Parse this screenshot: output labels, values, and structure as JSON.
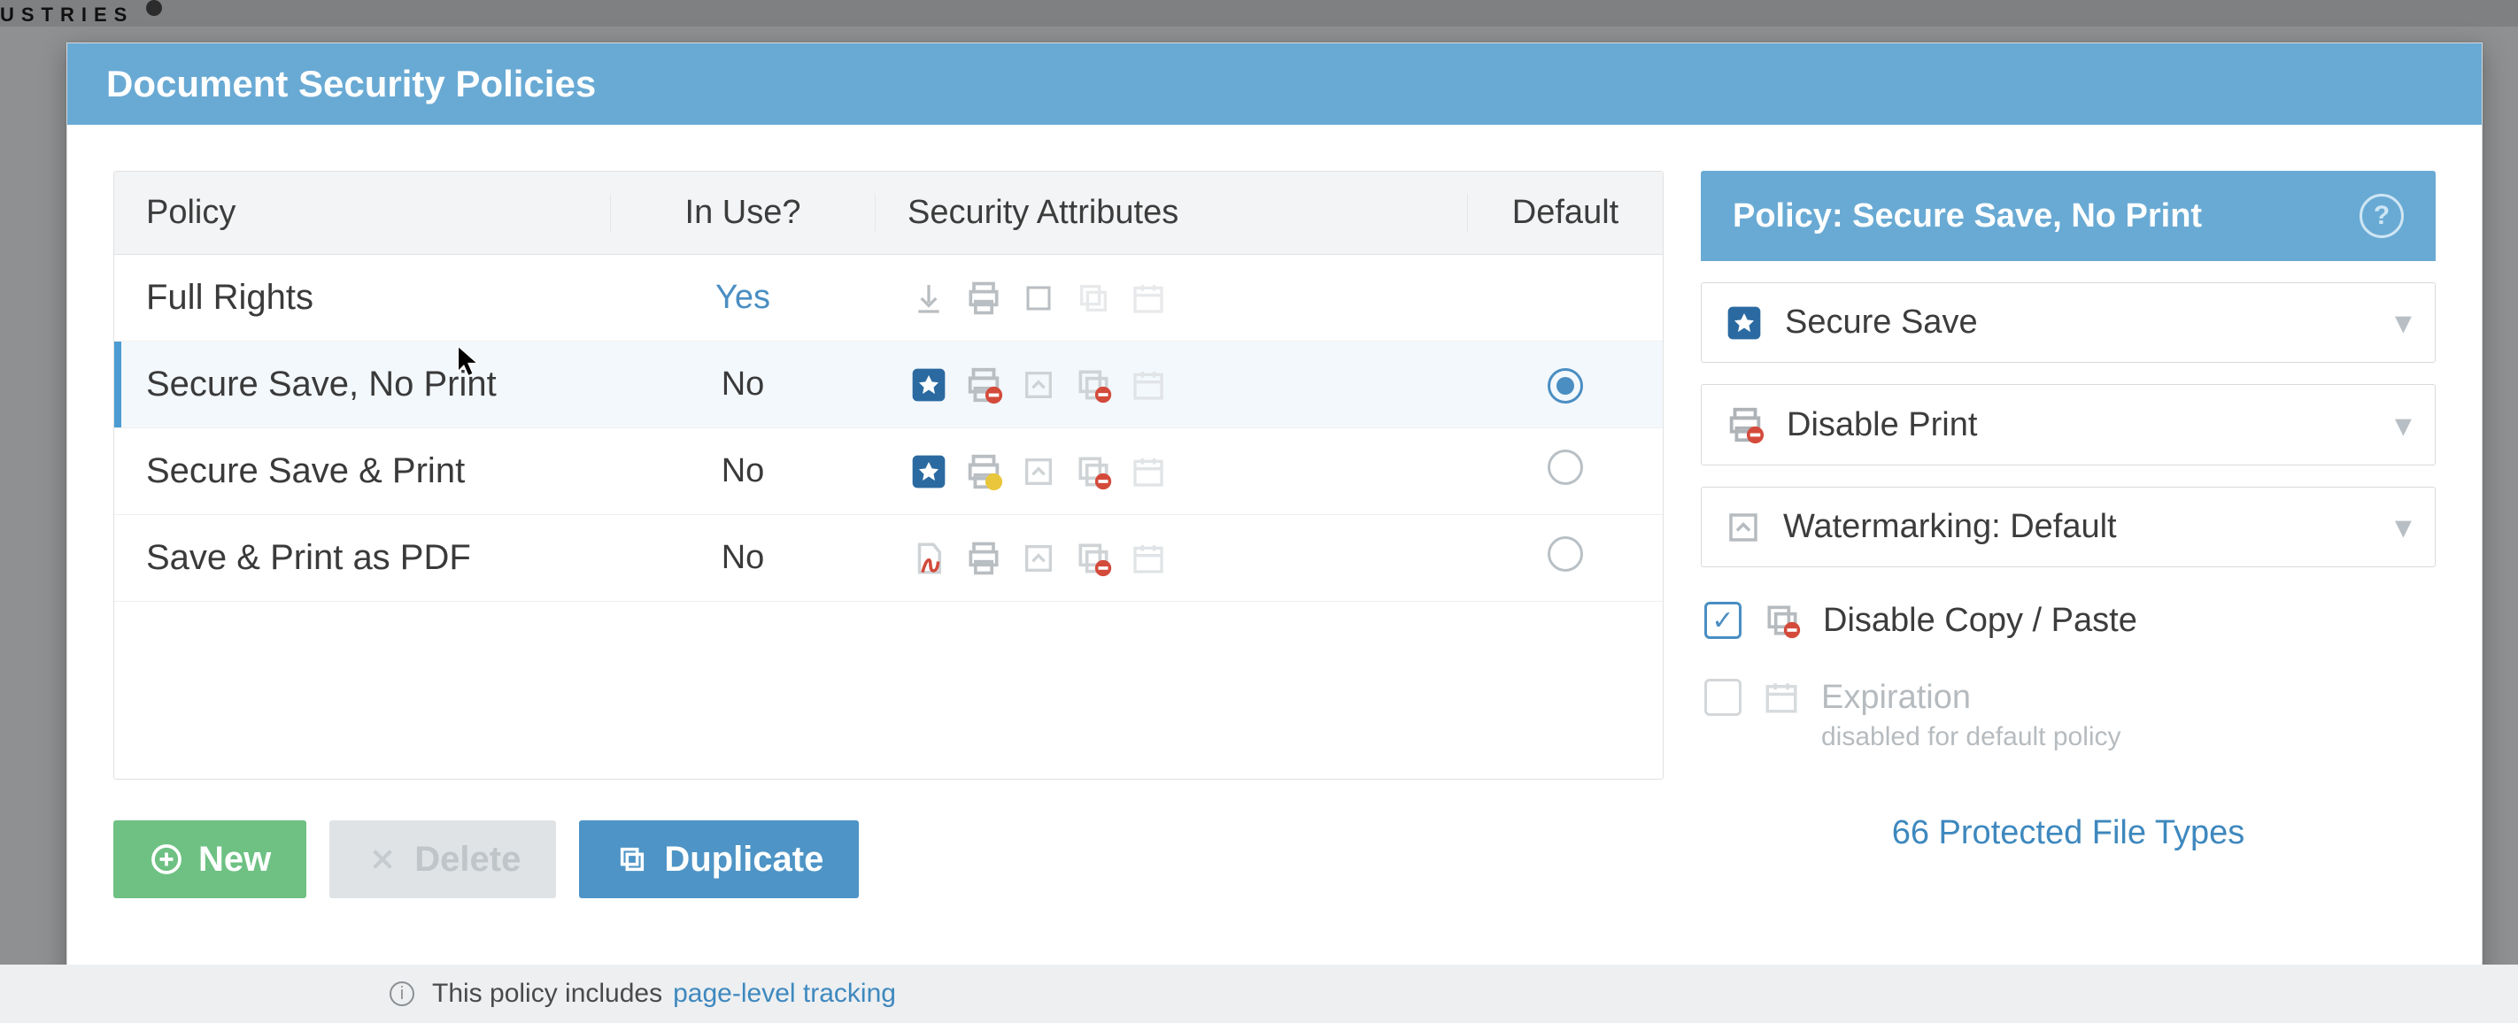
{
  "header": {
    "brand_fragment": "USTRIES"
  },
  "modal": {
    "title": "Document Security Policies"
  },
  "table": {
    "columns": {
      "policy": "Policy",
      "in_use": "In Use?",
      "attrs": "Security Attributes",
      "default": "Default"
    },
    "rows": [
      {
        "name": "Full Rights",
        "in_use": "Yes",
        "selected": false,
        "default": false
      },
      {
        "name": "Secure Save, No Print",
        "in_use": "No",
        "selected": true,
        "default": true
      },
      {
        "name": "Secure Save & Print",
        "in_use": "No",
        "selected": false,
        "default": false
      },
      {
        "name": "Save & Print as PDF",
        "in_use": "No",
        "selected": false,
        "default": false
      }
    ]
  },
  "buttons": {
    "new": "New",
    "delete": "Delete",
    "duplicate": "Duplicate"
  },
  "panel": {
    "title": "Policy: Secure Save, No Print",
    "dd_secure_save": "Secure Save",
    "dd_disable_print": "Disable Print",
    "dd_watermark": "Watermarking: Default",
    "disable_copy_paste": "Disable Copy / Paste",
    "expiration_label": "Expiration",
    "expiration_sub": "disabled for default policy",
    "footer_link": "66 Protected File Types"
  },
  "footer": {
    "text": "This policy includes ",
    "link": "page-level tracking"
  }
}
